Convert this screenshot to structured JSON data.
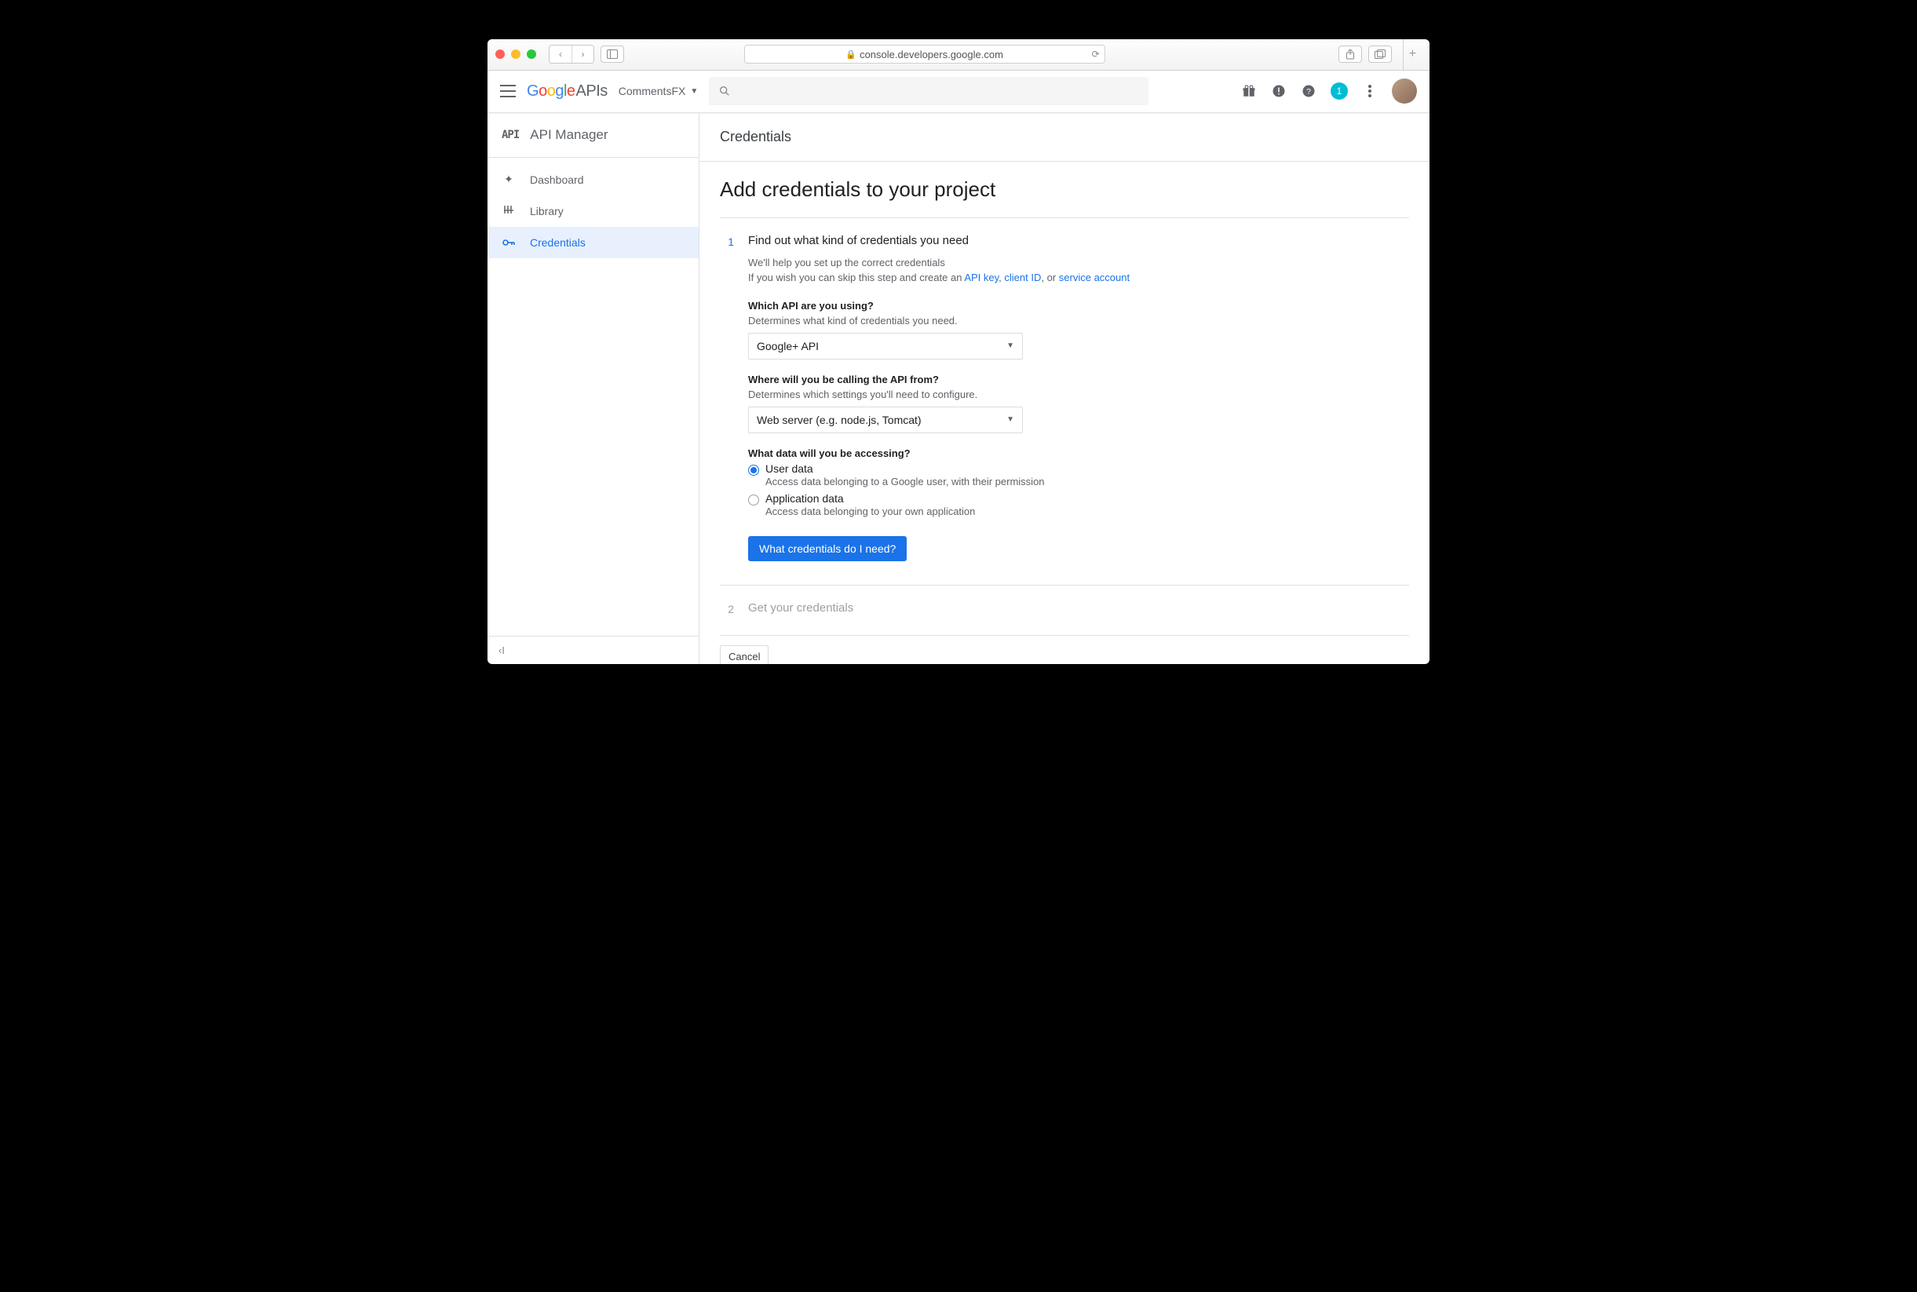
{
  "browser": {
    "url": "console.developers.google.com"
  },
  "header": {
    "logo_google": "Google",
    "logo_apis": "APIs",
    "project": "CommentsFX",
    "notif_count": "1"
  },
  "sidebar": {
    "title": "API Manager",
    "items": [
      {
        "label": "Dashboard"
      },
      {
        "label": "Library"
      },
      {
        "label": "Credentials"
      }
    ],
    "collapse_hint": "‹I"
  },
  "content": {
    "section": "Credentials",
    "page_title": "Add credentials to your project",
    "step1": {
      "num": "1",
      "title": "Find out what kind of credentials you need",
      "help1": "We'll help you set up the correct credentials",
      "help2_prefix": "If you wish you can skip this step and create an ",
      "link_api_key": "API key",
      "sep1": ", ",
      "link_client_id": "client ID",
      "sep2": ", or ",
      "link_service_account": "service account",
      "q_api_label": "Which API are you using?",
      "q_api_hint": "Determines what kind of credentials you need.",
      "q_api_value": "Google+ API",
      "q_from_label": "Where will you be calling the API from?",
      "q_from_hint": "Determines which settings you'll need to configure.",
      "q_from_value": "Web server (e.g. node.js, Tomcat)",
      "q_data_label": "What data will you be accessing?",
      "opt_user_label": "User data",
      "opt_user_desc": "Access data belonging to a Google user, with their permission",
      "opt_app_label": "Application data",
      "opt_app_desc": "Access data belonging to your own application",
      "cta": "What credentials do I need?"
    },
    "step2": {
      "num": "2",
      "title": "Get your credentials"
    },
    "cancel": "Cancel"
  }
}
